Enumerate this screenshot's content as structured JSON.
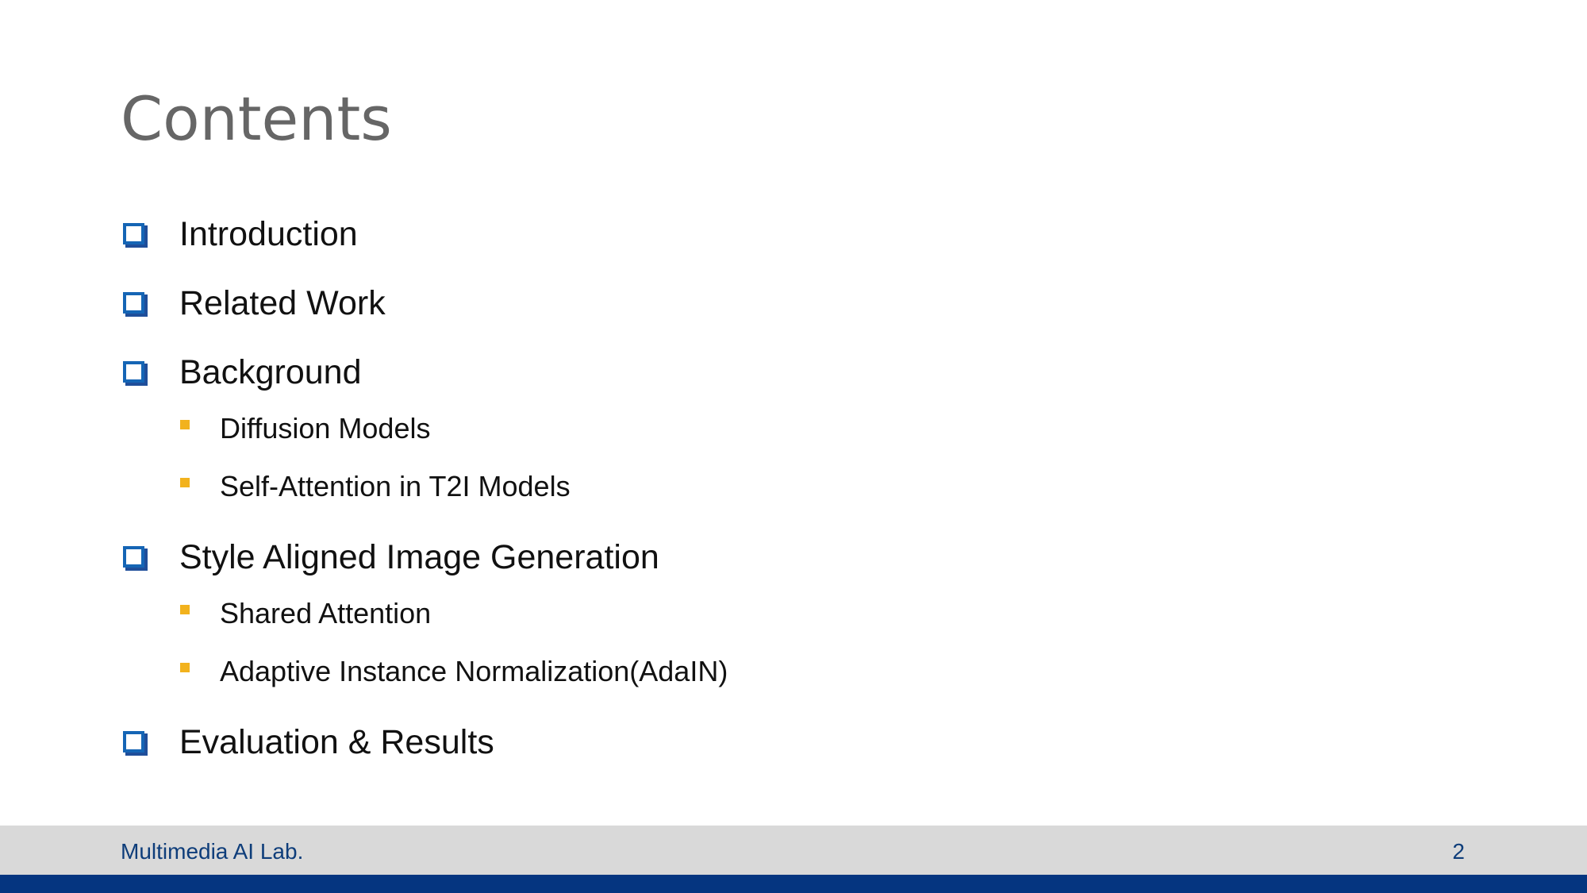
{
  "slide": {
    "title": "Contents"
  },
  "toc": {
    "items": [
      {
        "label": "Introduction"
      },
      {
        "label": "Related Work"
      },
      {
        "label": "Background",
        "subitems": [
          {
            "label": "Diffusion Models"
          },
          {
            "label": "Self-Attention in T2I Models"
          }
        ]
      },
      {
        "label": "Style Aligned Image Generation",
        "subitems": [
          {
            "label": "Shared Attention"
          },
          {
            "label": "Adaptive Instance Normalization(AdaIN)"
          }
        ]
      },
      {
        "label": "Evaluation & Results"
      }
    ]
  },
  "footer": {
    "lab_name": "Multimedia AI Lab.",
    "page_number": "2"
  },
  "colors": {
    "title": "#666666",
    "checkbox_bullet": "#1565b5",
    "sub_bullet": "#f2b21d",
    "footer_band": "#d9d9d9",
    "footer_text": "#0e3d7a",
    "bottom_bar": "#053580"
  },
  "icons": {
    "level1_bullet": "checkbox-icon",
    "level2_bullet": "square-bullet-icon"
  }
}
